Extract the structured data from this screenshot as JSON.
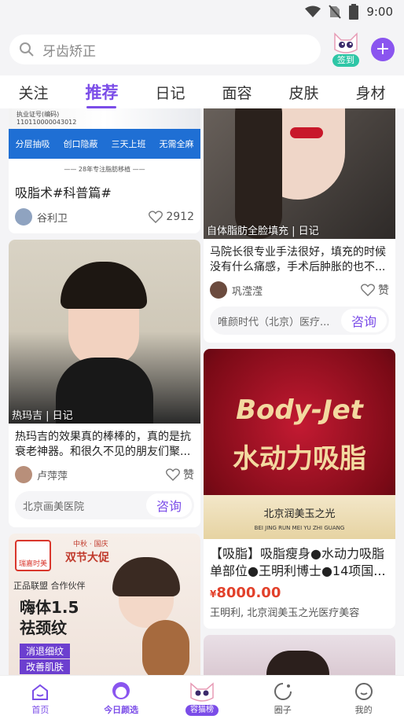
{
  "status": {
    "time": "9:00"
  },
  "search": {
    "placeholder": "牙齿矫正",
    "checkin_label": "签到"
  },
  "tabs": [
    {
      "label": "关注"
    },
    {
      "label": "推荐"
    },
    {
      "label": "日记"
    },
    {
      "label": "面容"
    },
    {
      "label": "皮肤"
    },
    {
      "label": "身材"
    }
  ],
  "left": {
    "card1": {
      "img_text_license": "执业证号(编码)",
      "img_text_code": "110110000043012",
      "features": [
        "分层抽吸",
        "创口隐蔽",
        "三天上班",
        "无需全麻"
      ],
      "footer_text": "—— 28年专注脂肪移植 ——",
      "title": "吸脂术#科普篇#",
      "author": "谷利卫",
      "likes": "2912"
    },
    "card2": {
      "caption": "热玛吉 | 日记",
      "title": "热玛吉的效果真的棒棒的，真的是抗衰老神器。和很久不见的朋友们聚...",
      "author": "卢萍萍",
      "likes": "赞",
      "hospital": "北京画美医院",
      "consult": "咨询"
    },
    "card3": {
      "logo_text": "瑞嘉时美",
      "promo_top": "中秋 · 国庆",
      "promo": "双节大促",
      "badge": "正品联盟 合作伙伴",
      "headline1": "嗨体1.5",
      "headline2": "祛颈纹",
      "bullet1": "消退细纹",
      "bullet2": "改善肌肤"
    }
  },
  "right": {
    "card1": {
      "caption": "自体脂肪全脸填充 | 日记",
      "title": "马院长很专业手法很好，填充的时候没有什么痛感，手术后肿胀的也不...",
      "author": "巩滢滢",
      "likes": "赞",
      "hospital": "唯颜时代（北京）医疗...",
      "consult": "咨询"
    },
    "card2": {
      "img_title1": "Body-Jet",
      "img_title2": "水动力吸脂",
      "brand": "北京润美玉之光",
      "brand_en": "BEI JING RUN MEI YU ZHI GUANG",
      "title": "【吸脂】吸脂瘦身●水动力吸脂单部位●王明利博士●14项国...",
      "price_symbol": "¥",
      "price": "8000.00",
      "shop": "王明利, 北京润美玉之光医疗美容"
    }
  },
  "bottom_nav": [
    {
      "label": "首页"
    },
    {
      "label": "今日颜选"
    },
    {
      "label": "容猫榜"
    },
    {
      "label": "圈子"
    },
    {
      "label": "我的"
    }
  ],
  "colors": {
    "accent": "#7b4de8",
    "price": "#e2412b",
    "checkin": "#2ec6a6"
  }
}
